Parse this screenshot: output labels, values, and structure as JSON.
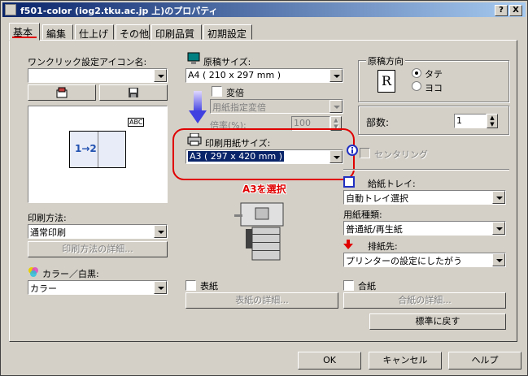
{
  "window": {
    "title": "f501-color (iog2.tku.ac.jp 上)のプロパティ",
    "help_btn": "?",
    "close_btn": "X"
  },
  "tabs": [
    "基本",
    "編集",
    "仕上げ",
    "その他",
    "印刷品質",
    "初期設定"
  ],
  "oneclick": {
    "label": "ワンクリック設定アイコン名:",
    "value": ""
  },
  "preview": {
    "abc": "ABC",
    "pages": "1→2"
  },
  "print_method": {
    "label": "印刷方法:",
    "value": "通常印刷",
    "details": "印刷方法の詳細..."
  },
  "color": {
    "label": "カラー／白黒:",
    "value": "カラー"
  },
  "original_size": {
    "label": "原稿サイズ:",
    "value": "A4 ( 210 x 297 mm )"
  },
  "scale": {
    "label": "変倍",
    "mode": "用紙指定変倍",
    "rate_label": "倍率(%):",
    "rate_value": "100"
  },
  "paper_size": {
    "label": "印刷用紙サイズ:",
    "value": "A3 ( 297 x 420 mm )"
  },
  "annotation": "A3を選択",
  "orientation": {
    "title": "原稿方向",
    "portrait": "タテ",
    "landscape": "ヨコ",
    "letter": "R"
  },
  "copies": {
    "label": "部数:",
    "value": "1"
  },
  "centering": "センタリング",
  "tray": {
    "label": "給紙トレイ:",
    "value": "自動トレイ選択"
  },
  "paper_type": {
    "label": "用紙種類:",
    "value": "普通紙/再生紙"
  },
  "output": {
    "label": "排紙先:",
    "value": "プリンターの設定にしたがう"
  },
  "cover": {
    "label": "表紙",
    "details": "表紙の詳細..."
  },
  "interleaf": {
    "label": "合紙",
    "details": "合紙の詳細..."
  },
  "buttons": {
    "restore": "標準に戻す",
    "ok": "OK",
    "cancel": "キャンセル",
    "help": "ヘルプ"
  },
  "colors": {
    "accent_red": "#e00000",
    "title_blue": "#0a246a",
    "face": "#d4d0c8"
  }
}
